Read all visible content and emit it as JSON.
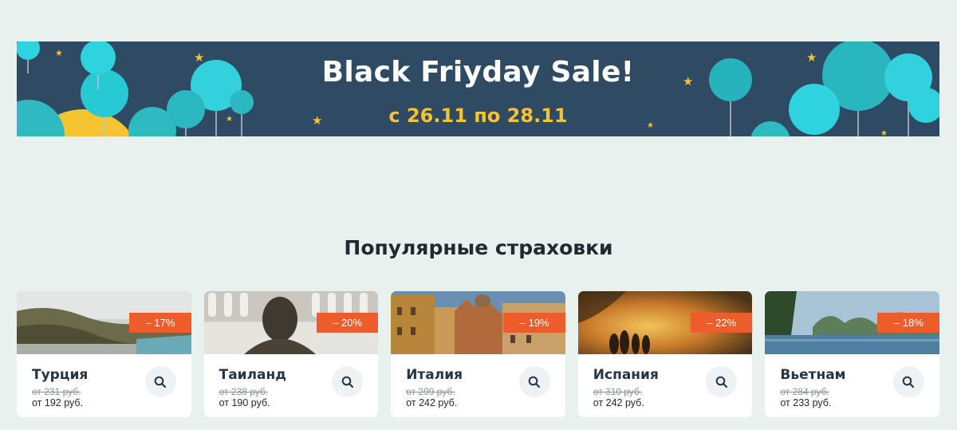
{
  "banner": {
    "title": "Black Friyday Sale!",
    "dates": "с 26.11 по 28.11",
    "bg_color": "#2f4a63",
    "title_color": "#ffffff",
    "dates_color": "#f7c233"
  },
  "section": {
    "title": "Популярные страховки"
  },
  "accent_color": "#ee5c2b",
  "cards": [
    {
      "country": "Турция",
      "discount": "– 17%",
      "old_price": "от 231 руб.",
      "new_price": "от 192 руб."
    },
    {
      "country": "Таиланд",
      "discount": "– 20%",
      "old_price": "от 238 руб.",
      "new_price": "от 190 руб."
    },
    {
      "country": "Италия",
      "discount": "– 19%",
      "old_price": "от 299 руб.",
      "new_price": "от 242 руб."
    },
    {
      "country": "Испания",
      "discount": "– 22%",
      "old_price": "от 310 руб.",
      "new_price": "от 242 руб."
    },
    {
      "country": "Вьетнам",
      "discount": "– 18%",
      "old_price": "от 284 руб.",
      "new_price": "от 233 руб."
    }
  ]
}
